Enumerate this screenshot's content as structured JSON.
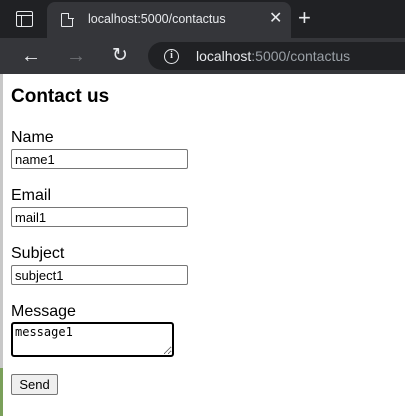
{
  "browser": {
    "tab_title": "localhost:5000/contactus",
    "tab_close_glyph": "✕",
    "new_tab_glyph": "+",
    "back_glyph": "←",
    "forward_glyph": "→",
    "reload_glyph": "↻",
    "info_glyph": "i",
    "url_host": "localhost",
    "url_rest": ":5000/contactus",
    "icons": [
      "window-icon",
      "page-icon",
      "close-icon",
      "plus-icon",
      "back-arrow-icon",
      "forward-arrow-icon",
      "reload-icon",
      "info-icon"
    ]
  },
  "page": {
    "title": "Contact us",
    "form": {
      "name_label": "Name",
      "name_value": "name1",
      "email_label": "Email",
      "email_value": "mail1",
      "subject_label": "Subject",
      "subject_value": "subject1",
      "message_label": "Message",
      "message_value": "message1",
      "send_label": "Send"
    }
  },
  "colors": {
    "tabstrip": "#202124",
    "toolbar": "#35363a",
    "chrome_text": "#e8eaed",
    "url_dim_text": "#9aa0a6",
    "page_background": "#ffffff"
  }
}
